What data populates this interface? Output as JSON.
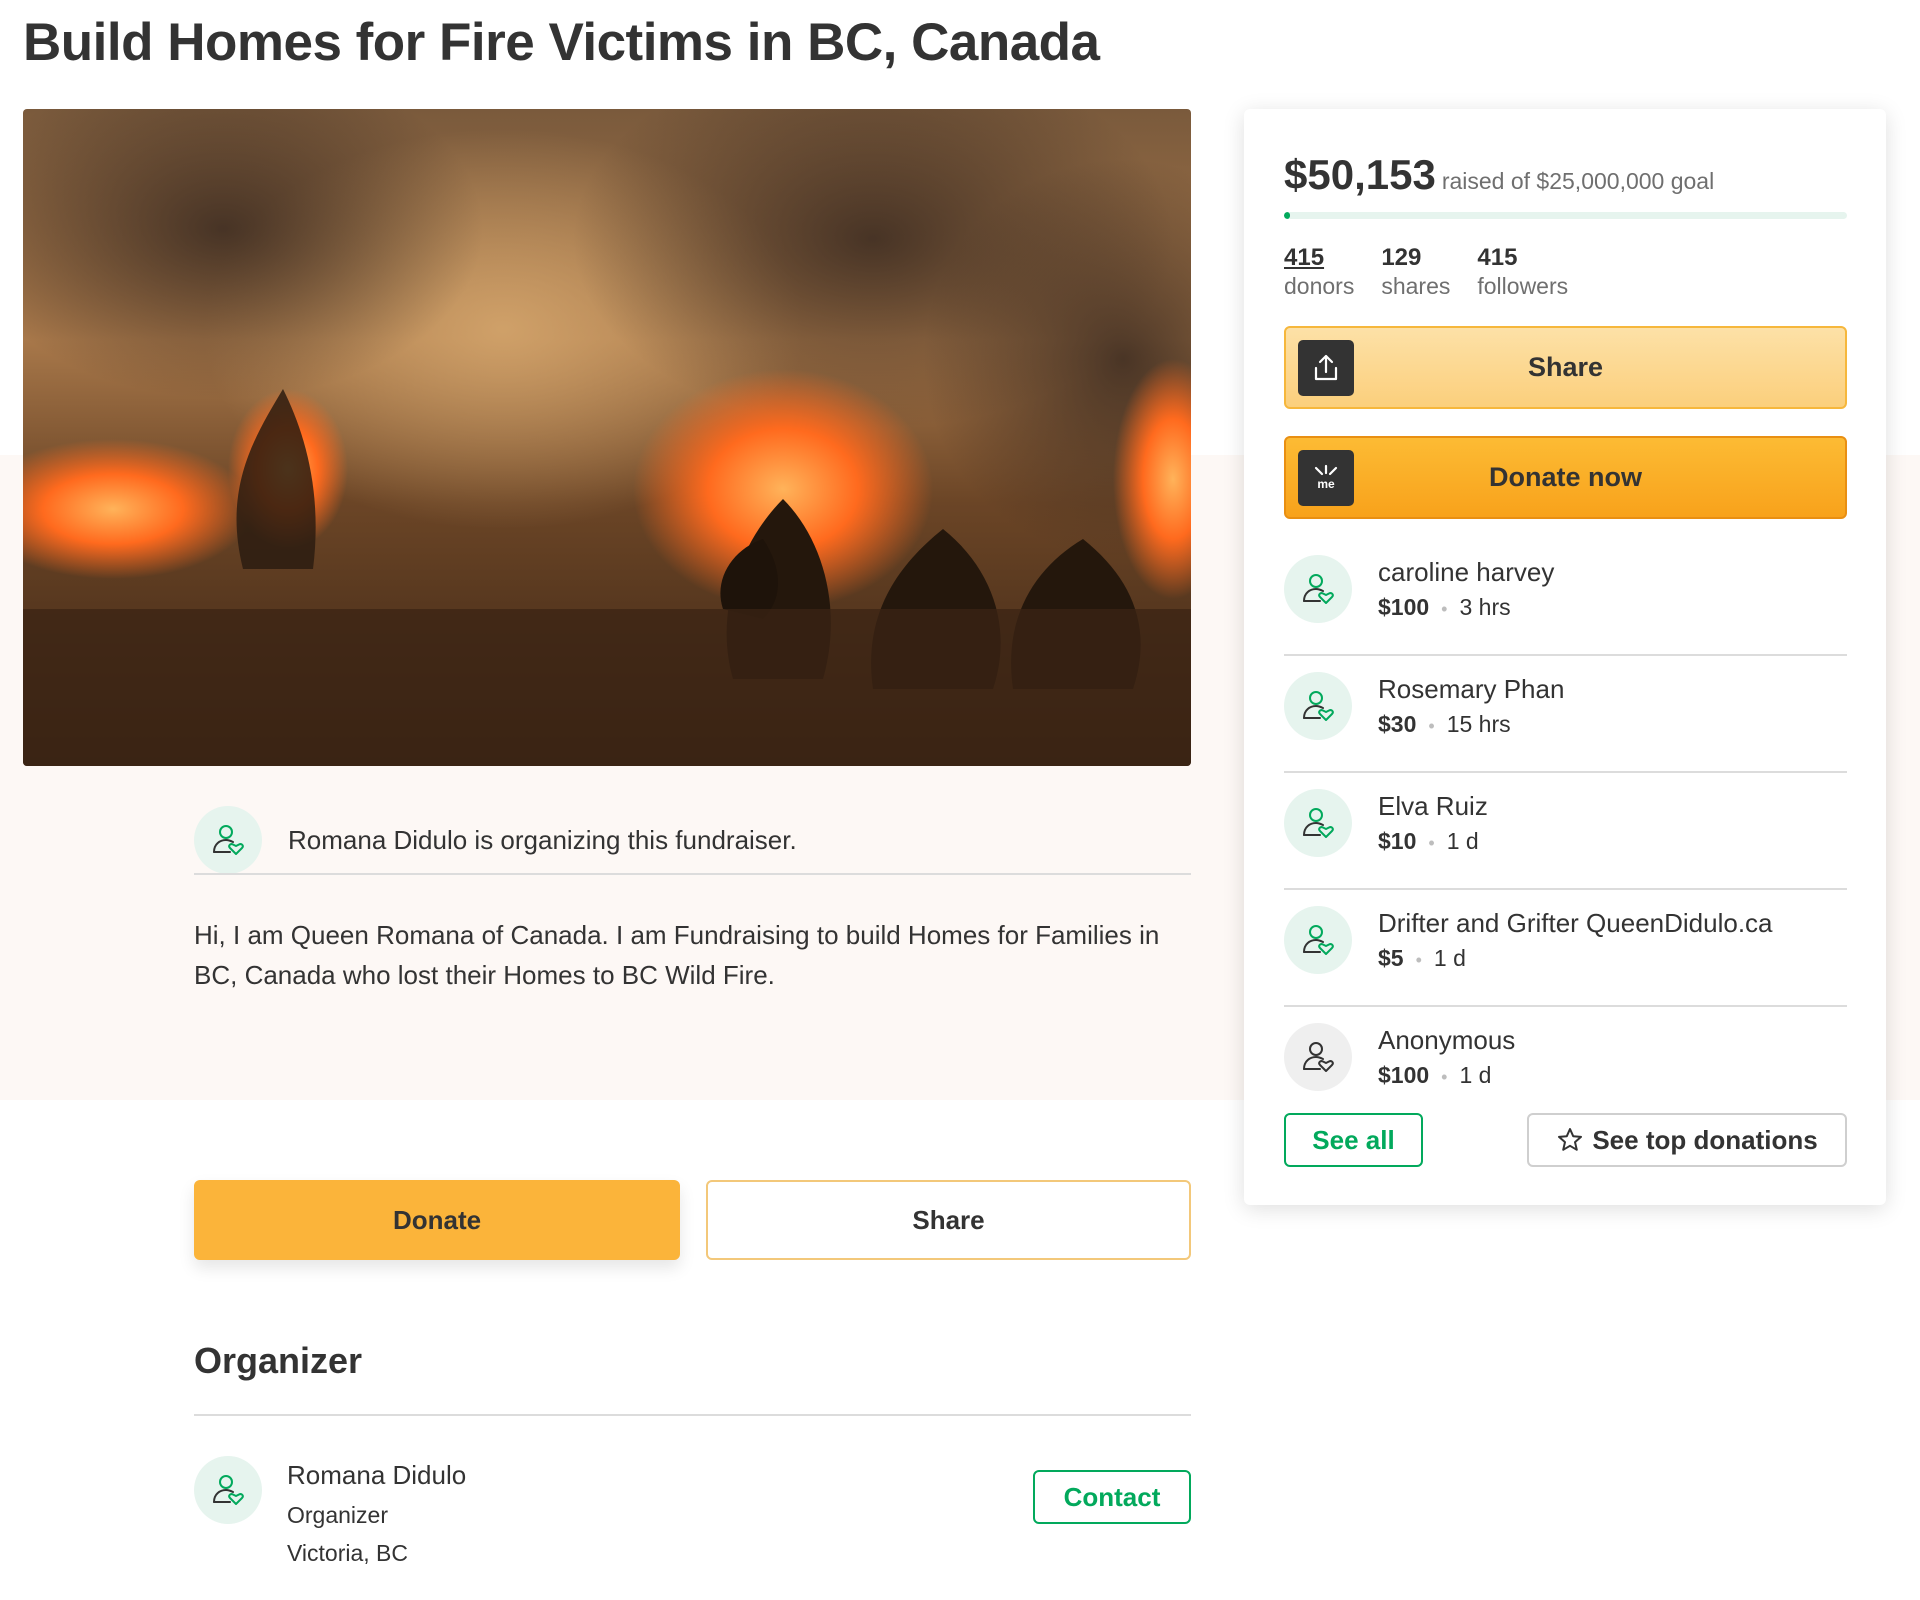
{
  "page": {
    "title": "Build Homes for Fire Victims in BC, Canada"
  },
  "organizing_notice": "Romana Didulo is organizing this fundraiser.",
  "story": "Hi, I am Queen Romana of Canada. I am Fundraising to build Homes for Families in BC, Canada who lost their Homes to BC Wild Fire.",
  "actions": {
    "donate_label": "Donate",
    "share_label": "Share"
  },
  "organizer": {
    "heading": "Organizer",
    "name": "Romana Didulo",
    "role": "Organizer",
    "location": "Victoria, BC",
    "contact_label": "Contact"
  },
  "sidebar": {
    "raised_amount": "$50,153",
    "raised_text": "raised of $25,000,000 goal",
    "progress_fraction": 0.002,
    "stats": [
      {
        "num": "415",
        "label": "donors"
      },
      {
        "num": "129",
        "label": "shares"
      },
      {
        "num": "415",
        "label": "followers"
      }
    ],
    "share_label": "Share",
    "donate_now_label": "Donate now",
    "donations": [
      {
        "name": "caroline harvey",
        "amount": "$100",
        "time": "3 hrs"
      },
      {
        "name": "Rosemary Phan",
        "amount": "$30",
        "time": "15 hrs"
      },
      {
        "name": "Elva Ruiz",
        "amount": "$10",
        "time": "1 d"
      },
      {
        "name": "Drifter and Grifter QueenDidulo.ca",
        "amount": "$5",
        "time": "1 d"
      },
      {
        "name": "Anonymous",
        "amount": "$100",
        "time": "1 d"
      }
    ],
    "see_all_label": "See all",
    "top_donations_label": "See top donations"
  },
  "colors": {
    "brand_green": "#02a95c",
    "donate_orange": "#fbb43a",
    "text": "#333333"
  },
  "icons": {
    "donor_avatar": "person-heart-icon",
    "share": "upload-share-icon",
    "donate": "gofundme-logo-icon",
    "top_donations": "star-outline-icon"
  }
}
